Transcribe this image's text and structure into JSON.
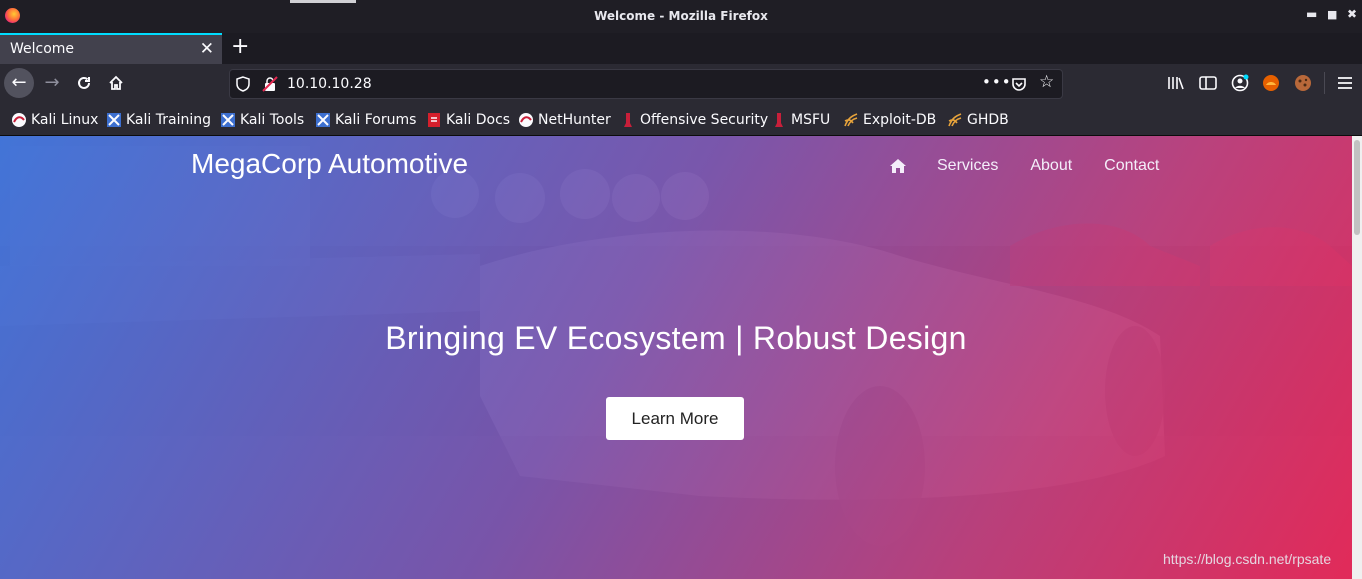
{
  "window": {
    "title": "Welcome - Mozilla Firefox"
  },
  "tabs": [
    {
      "label": "Welcome",
      "active": true
    }
  ],
  "navbar": {
    "url": "10.10.10.28"
  },
  "bookmarks": [
    {
      "label": "Kali Linux",
      "icon": "kali-dragon-icon"
    },
    {
      "label": "Kali Training",
      "icon": "kali-training-icon"
    },
    {
      "label": "Kali Tools",
      "icon": "kali-tools-icon"
    },
    {
      "label": "Kali Forums",
      "icon": "kali-forums-icon"
    },
    {
      "label": "Kali Docs",
      "icon": "kali-docs-icon"
    },
    {
      "label": "NetHunter",
      "icon": "nethunter-icon"
    },
    {
      "label": "Offensive Security",
      "icon": "offsec-icon"
    },
    {
      "label": "MSFU",
      "icon": "msfu-icon"
    },
    {
      "label": "Exploit-DB",
      "icon": "exploit-db-icon"
    },
    {
      "label": "GHDB",
      "icon": "ghdb-icon"
    }
  ],
  "site": {
    "brand": "MegaCorp Automotive",
    "nav": [
      "Services",
      "About",
      "Contact"
    ],
    "headline": "Bringing EV Ecosystem | Robust Design",
    "cta": "Learn More"
  },
  "watermark": "https://blog.csdn.net/rpsate",
  "colors": {
    "gradient_start": "#4075db",
    "gradient_end": "#e82857",
    "tab_accent": "#00ddff"
  }
}
